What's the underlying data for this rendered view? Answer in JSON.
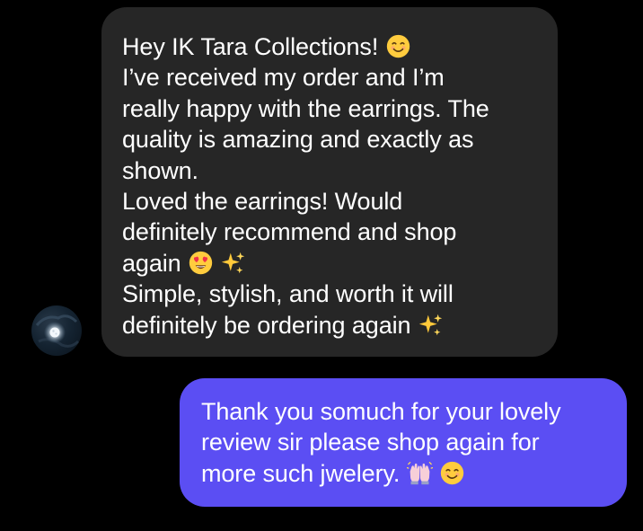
{
  "incoming_message": {
    "line1": "Hey IK Tara Collections!",
    "line2": "I’ve received my order and I’m",
    "line3": "really happy with the earrings. The",
    "line4": "quality is amazing and exactly as",
    "line5": "shown.",
    "line6": "Loved the earrings! Would",
    "line7": "definitely recommend and shop",
    "line8": "again",
    "line9": "Simple, stylish, and worth it will",
    "line10": "definitely be ordering again",
    "emoji_1": "smiling-face-icon",
    "emoji_2": "heart-eyes-face-icon",
    "emoji_3": "sparkles-icon",
    "emoji_4": "sparkles-icon"
  },
  "outgoing_message": {
    "line1": "Thank you somuch for your lovely",
    "line2": "review sir please shop again for",
    "line3": "more such jwelery.",
    "emoji_1": "raising-hands-icon",
    "emoji_2": "smiling-face-icon"
  },
  "colors": {
    "background": "#000000",
    "incoming_bubble": "#262626",
    "outgoing_bubble": "#5b4ef3",
    "text": "#ffffff"
  }
}
